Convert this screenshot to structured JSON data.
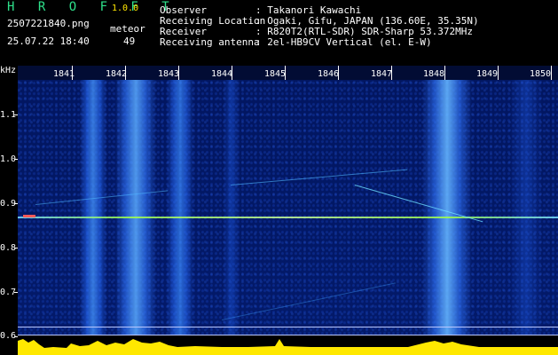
{
  "header": {
    "logo_text": "H R O F F T",
    "version": "1.0.0",
    "filename": "2507221840.png",
    "datetime": "25.07.22 18:40",
    "meteor_label": "meteor",
    "meteor_count": "49",
    "info": [
      {
        "key": "Observer",
        "value": ": Takanori Kawachi"
      },
      {
        "key": "Receiving Location",
        "value": ": Ogaki, Gifu, JAPAN (136.60E, 35.35N)"
      },
      {
        "key": "Receiver",
        "value": ": R820T2(RTL-SDR) SDR-Sharp 53.372MHz"
      },
      {
        "key": "Receiving antenna",
        "value": ": 2el-HB9CV Vertical (el. E-W)"
      }
    ]
  },
  "axis": {
    "y_unit": "kHz",
    "x_ticks": [
      "1841",
      "1842",
      "1843",
      "1844",
      "1845",
      "1846",
      "1847",
      "1848",
      "1849",
      "1850"
    ],
    "y_ticks": [
      "1.1",
      "1.0",
      "0.9",
      "0.8",
      "0.7",
      "0.6"
    ]
  },
  "colors": {
    "signal": "#9fff4a",
    "meteor_echo": "#ff5a5a",
    "spectrum": "#ffe800",
    "background": "#02134f"
  }
}
